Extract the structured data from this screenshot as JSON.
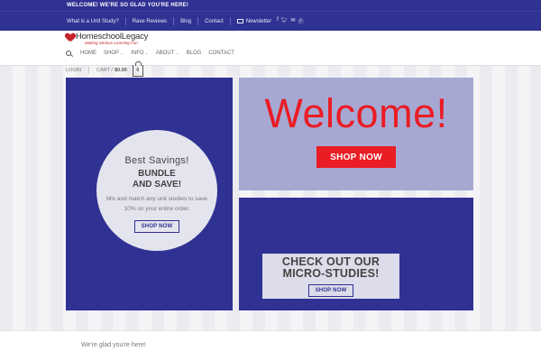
{
  "topbar": {
    "message": "WELCOME! WE'RE SO GLAD YOU'RE HERE!"
  },
  "secondary_nav": {
    "links": [
      "What is a Unit Study?",
      "Rave Reviews",
      "Blog",
      "Contact"
    ],
    "newsletter": "Newsletter",
    "social_icons": [
      "facebook-icon",
      "twitter-icon",
      "email-icon",
      "pinterest-icon"
    ]
  },
  "logo": {
    "name": "HomeschoolLegacy",
    "tagline": "Making Serious Learning Fun"
  },
  "main_nav": {
    "home": "HOME",
    "shop": "SHOP",
    "info": "INFO",
    "about": "ABOUT",
    "blog": "BLOG",
    "contact": "CONTACT"
  },
  "account": {
    "login": "LOGIN",
    "cart_label": "CART /",
    "cart_total": "$0.00",
    "cart_count": "0"
  },
  "promo_left": {
    "title": "Best Savings!",
    "bundle_line1": "BUNDLE",
    "bundle_line2": "AND SAVE!",
    "description": "Mix and match any unit studies to save 10% on your entire order.",
    "button": "SHOP NOW"
  },
  "promo_welcome": {
    "title": "Welcome!",
    "button": "SHOP NOW"
  },
  "promo_micro": {
    "title_line1": "CHECK OUT OUR",
    "title_line2": "MICRO-STUDIES!",
    "button": "SHOP NOW"
  },
  "footer": {
    "text": "We're glad you're here!"
  },
  "colors": {
    "brand_blue": "#2f3193",
    "accent_red": "#ea1c24",
    "light_blue": "#a6a8d3"
  }
}
